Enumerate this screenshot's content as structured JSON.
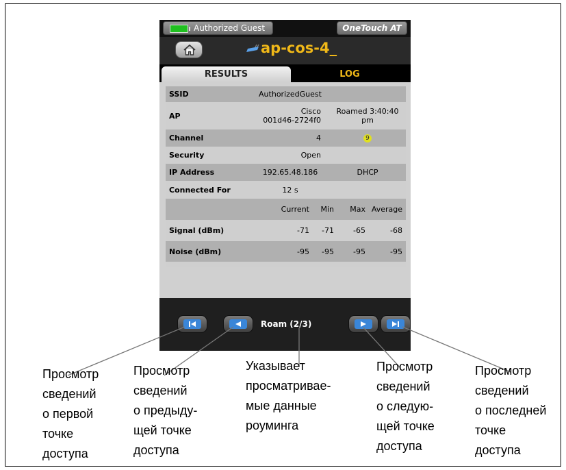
{
  "status_bar": {
    "network": "Authorized Guest",
    "brand": "OneTouch AT"
  },
  "header": {
    "title": "ap-cos-4_"
  },
  "tabs": [
    {
      "label": "RESULTS",
      "active": true
    },
    {
      "label": "LOG",
      "active": false
    }
  ],
  "table": {
    "ssid": {
      "label": "SSID",
      "value": "AuthorizedGuest"
    },
    "ap": {
      "label": "AP",
      "vendor": "Cisco",
      "mac": "001d46-2724f0",
      "roamed_line1": "Roamed 3:40:40",
      "roamed_line2": "pm"
    },
    "channel": {
      "label": "Channel",
      "value": "4",
      "badge": "9"
    },
    "security": {
      "label": "Security",
      "value": "Open"
    },
    "ip": {
      "label": "IP Address",
      "value": "192.65.48.186",
      "mode": "DHCP"
    },
    "connected": {
      "label": "Connected For",
      "value": "12 s"
    },
    "stats_header": {
      "current": "Current",
      "min": "Min",
      "max": "Max",
      "average": "Average"
    },
    "signal": {
      "label": "Signal (dBm)",
      "current": "-71",
      "min": "-71",
      "max": "-65",
      "average": "-68"
    },
    "noise": {
      "label": "Noise (dBm)",
      "current": "-95",
      "min": "-95",
      "max": "-95",
      "average": "-95"
    }
  },
  "nav": {
    "roam_label": "Roam (2/3)"
  },
  "callouts": {
    "first": "Просмотр\nсведений\nо первой\nточке\nдоступа",
    "previous": "Просмотр\nсведений\nо предыду-\nщей точке\nдоступа",
    "indicator": "Указывает\nпросматривае-\nмые данные\nроуминга",
    "next": "Просмотр\nсведений\nо следую-\nщей точке\nдоступа",
    "last": "Просмотр\nсведений\nо последней\nточке\nдоступа"
  },
  "colors": {
    "accent": "#f0b818",
    "button_blue": "#3a86d8",
    "battery": "#20c020"
  }
}
